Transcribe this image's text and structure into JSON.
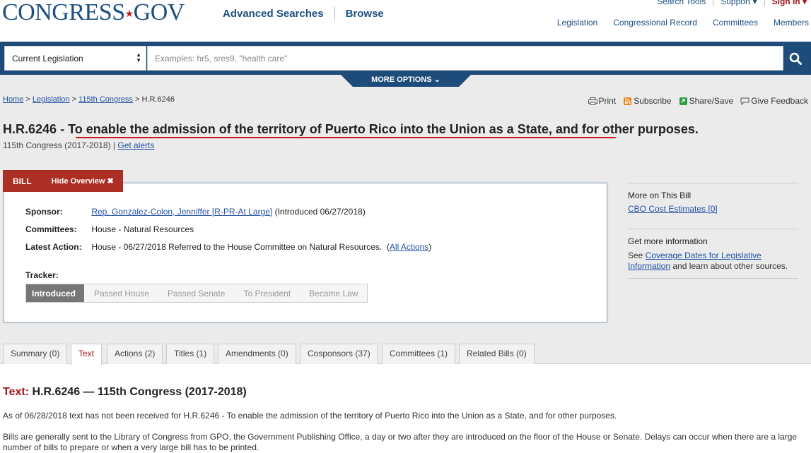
{
  "header": {
    "logo_main": "CONGRESS",
    "logo_star": "★",
    "logo_gov": "GOV",
    "nav": [
      "Advanced Searches",
      "Browse"
    ],
    "util": [
      "Search Tools",
      "Support ▾",
      "Sign In ▾"
    ],
    "secondary": [
      "Legislation",
      "Congressional Record",
      "Committees",
      "Members"
    ]
  },
  "search": {
    "scope": "Current Legislation",
    "placeholder": "Examples: hr5, sres9, \"health care\"",
    "more_options": "MORE OPTIONS"
  },
  "breadcrumb": {
    "home": "Home",
    "legislation": "Legislation",
    "congress": "115th Congress",
    "current": "H.R.6246",
    "sep": ">"
  },
  "toolbar": {
    "print": "Print",
    "subscribe": "Subscribe",
    "share": "Share/Save",
    "feedback": "Give Feedback"
  },
  "bill": {
    "number": "H.R.6246",
    "dash": "-",
    "title": "To enable the admission of the territory of Puerto Rico into the Union as a State, and for other purposes.",
    "congress": "115th Congress (2017-2018)",
    "separator": "|",
    "get_alerts": "Get alerts"
  },
  "overview": {
    "tab_label": "BILL",
    "hide_label": "Hide Overview ✖",
    "sponsor_label": "Sponsor:",
    "sponsor": "Rep. Gonzalez-Colon, Jenniffer [R-PR-At Large]",
    "introduced": "(Introduced 06/27/2018)",
    "committees_label": "Committees:",
    "committees": "House - Natural Resources",
    "latest_label": "Latest Action:",
    "latest": "House - 06/27/2018 Referred to the House Committee on Natural Resources.",
    "all_actions": "All Actions",
    "tracker_label": "Tracker:",
    "tracker": [
      "Introduced",
      "Passed House",
      "Passed Senate",
      "To President",
      "Became Law"
    ]
  },
  "sidebar": {
    "more_heading": "More on This Bill",
    "cbo": "CBO Cost Estimates [0]",
    "info_heading": "Get more information",
    "see": "See",
    "coverage": "Coverage Dates for Legislative Information",
    "learn": "and learn about other sources."
  },
  "tabs": [
    "Summary (0)",
    "Text",
    "Actions (2)",
    "Titles (1)",
    "Amendments (0)",
    "Cosponsors (37)",
    "Committees (1)",
    "Related Bills (0)"
  ],
  "content": {
    "heading_label": "Text:",
    "heading": "H.R.6246 — 115th Congress (2017-2018)",
    "para1": "As of 06/28/2018 text has not been received for H.R.6246 - To enable the admission of the territory of Puerto Rico into the Union as a State, and for other purposes.",
    "para2": "Bills are generally sent to the Library of Congress from GPO, the Government Publishing Office, a day or two after they are introduced on the floor of the House or Senate. Delays can occur when there are a large number of bills to prepare or when a very large bill has to be printed."
  }
}
